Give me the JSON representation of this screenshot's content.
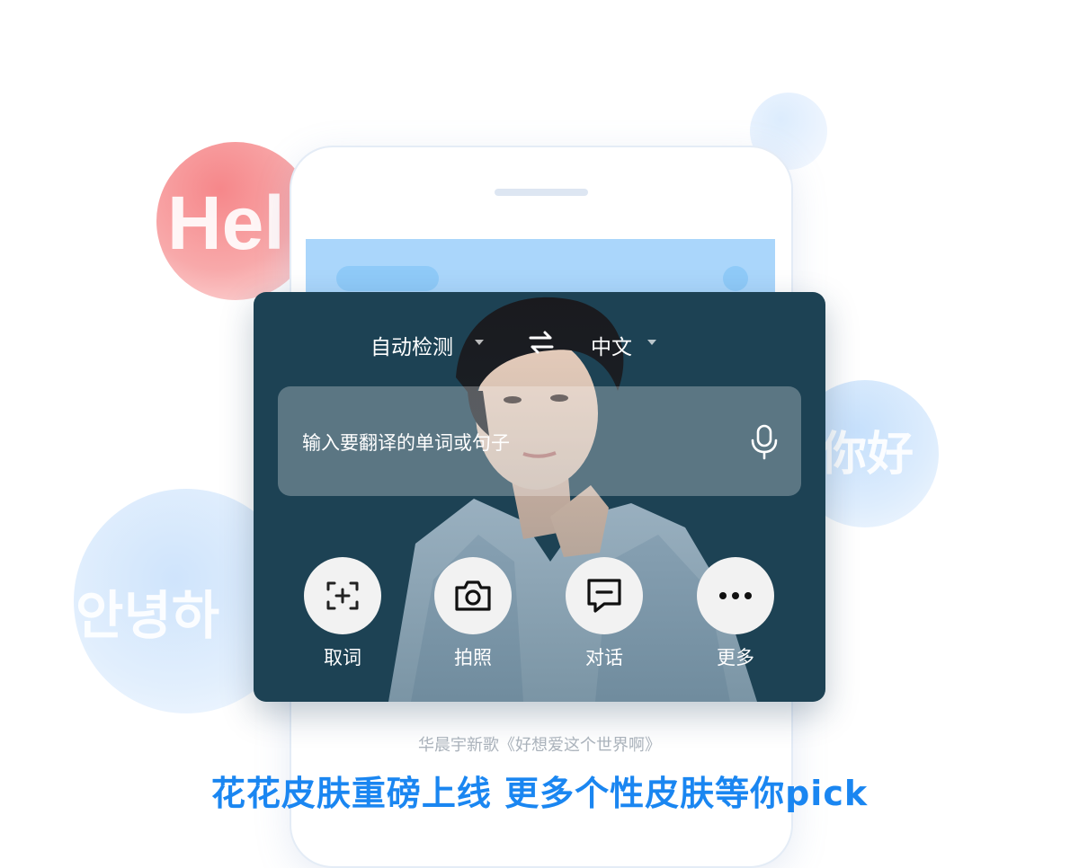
{
  "bubbles": {
    "hello": "Hel",
    "nihao": "你好",
    "korean": "안녕하"
  },
  "translator": {
    "source_lang": "自动检测",
    "target_lang": "中文",
    "input_placeholder": "输入要翻译的单词或句子"
  },
  "tools": [
    {
      "label": "取词",
      "icon": "scan-word-icon"
    },
    {
      "label": "拍照",
      "icon": "camera-icon"
    },
    {
      "label": "对话",
      "icon": "chat-icon"
    },
    {
      "label": "更多",
      "icon": "more-icon"
    }
  ],
  "caption": "华晨宇新歌《好想爱这个世界啊》",
  "headline": "花花皮肤重磅上线 更多个性皮肤等你pick",
  "colors": {
    "accent": "#1a86f1",
    "card_bg": "#1d4254",
    "hello_bubble": "#f78d90",
    "blue_bubble": "#d6e9fd"
  }
}
